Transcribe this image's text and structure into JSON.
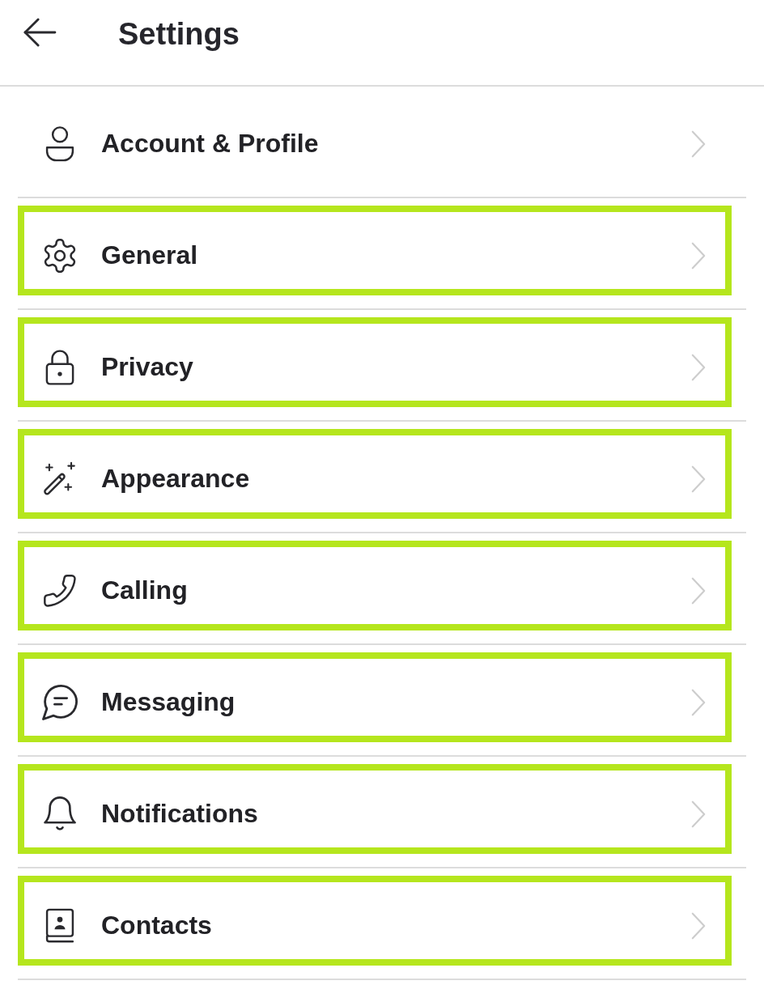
{
  "header": {
    "title": "Settings"
  },
  "items": [
    {
      "label": "Account & Profile",
      "highlighted": false
    },
    {
      "label": "General",
      "highlighted": true
    },
    {
      "label": "Privacy",
      "highlighted": true
    },
    {
      "label": "Appearance",
      "highlighted": true
    },
    {
      "label": "Calling",
      "highlighted": true
    },
    {
      "label": "Messaging",
      "highlighted": true
    },
    {
      "label": "Notifications",
      "highlighted": true
    },
    {
      "label": "Contacts",
      "highlighted": true
    }
  ]
}
